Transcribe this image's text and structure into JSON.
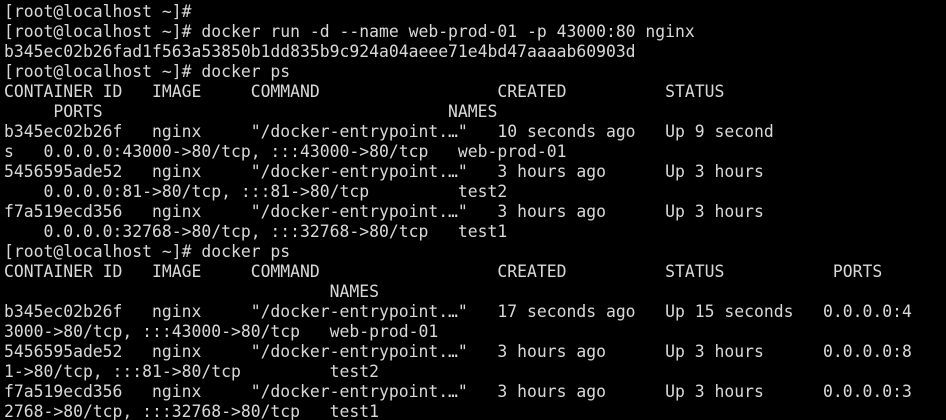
{
  "terminal": {
    "lines": [
      "[root@localhost ~]#",
      "[root@localhost ~]# docker run -d --name web-prod-01 -p 43000:80 nginx",
      "b345ec02b26fad1f563a53850b1dd835b9c924a04aeee71e4bd47aaaab60903d",
      "[root@localhost ~]# docker ps",
      "CONTAINER ID   IMAGE     COMMAND                  CREATED          STATUS",
      "     PORTS                                   NAMES",
      "b345ec02b26f   nginx     \"/docker-entrypoint.…\"   10 seconds ago   Up 9 second",
      "s   0.0.0.0:43000->80/tcp, :::43000->80/tcp   web-prod-01",
      "5456595ade52   nginx     \"/docker-entrypoint.…\"   3 hours ago      Up 3 hours",
      "    0.0.0.0:81->80/tcp, :::81->80/tcp         test2",
      "f7a519ecd356   nginx     \"/docker-entrypoint.…\"   3 hours ago      Up 3 hours",
      "    0.0.0.0:32768->80/tcp, :::32768->80/tcp   test1",
      "[root@localhost ~]# docker ps",
      "CONTAINER ID   IMAGE     COMMAND                  CREATED          STATUS           PORTS",
      "                                 NAMES",
      "b345ec02b26f   nginx     \"/docker-entrypoint.…\"   17 seconds ago   Up 15 seconds   0.0.0.0:4",
      "3000->80/tcp, :::43000->80/tcp   web-prod-01",
      "5456595ade52   nginx     \"/docker-entrypoint.…\"   3 hours ago      Up 3 hours      0.0.0.0:8",
      "1->80/tcp, :::81->80/tcp         test2",
      "f7a519ecd356   nginx     \"/docker-entrypoint.…\"   3 hours ago      Up 3 hours      0.0.0.0:3",
      "2768->80/tcp, :::32768->80/tcp   test1"
    ]
  },
  "colors": {
    "background": "#000000",
    "foreground": "#d9d9d9"
  }
}
